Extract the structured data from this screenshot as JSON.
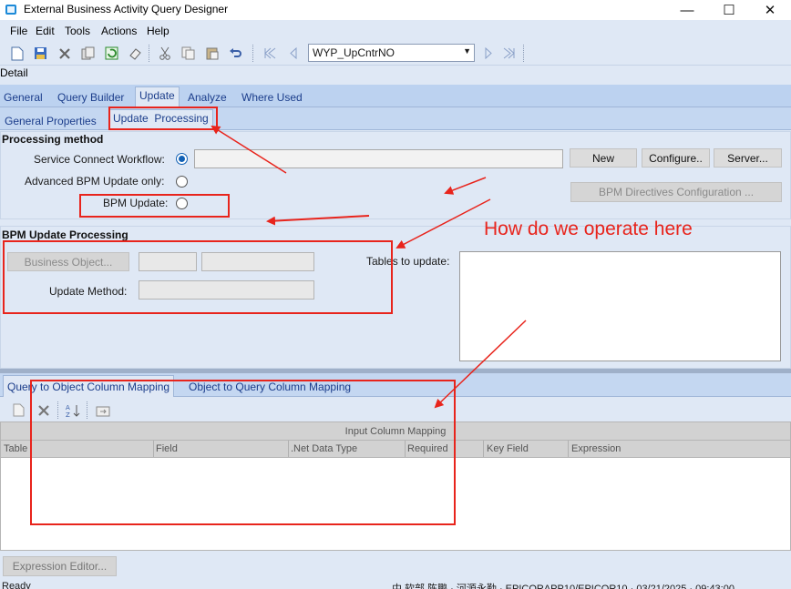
{
  "window": {
    "title": "External Business Activity Query Designer",
    "controls": {
      "minimize": "—",
      "maximize": "☐",
      "close": "✕"
    }
  },
  "menu": [
    "File",
    "Edit",
    "Tools",
    "Actions",
    "Help"
  ],
  "toolbar": {
    "icons": [
      "new-icon",
      "save-icon",
      "delete-icon",
      "copy-icon",
      "refresh-icon",
      "clear-icon",
      "cut-icon",
      "duplicate-icon",
      "paste-icon",
      "undo-icon",
      "first-record-icon",
      "previous-record-icon",
      "next-record-icon",
      "last-record-icon"
    ],
    "record_combo": "WYP_UpCntrNO"
  },
  "detail_label": "Detail",
  "main_tabs": [
    {
      "label": "General",
      "active": false
    },
    {
      "label": "Query Builder",
      "active": false
    },
    {
      "label": "Update",
      "active": true
    },
    {
      "label": "Analyze",
      "active": false
    },
    {
      "label": "Where Used",
      "active": false
    }
  ],
  "sub_tabs": [
    {
      "label": "General Properties",
      "active": false
    },
    {
      "label": "Update  Processing",
      "active": true
    }
  ],
  "processing_method": {
    "title": "Processing method",
    "service_connect_label": "Service Connect Workflow:",
    "advanced_bpm_label": "Advanced BPM Update only:",
    "bpm_update_label": "BPM Update:",
    "selected": "service_connect",
    "new_button": "New",
    "configure_button": "Configure..",
    "server_button": "Server...",
    "bpm_directives_button": "BPM Directives Configuration ..."
  },
  "bpm_update_processing": {
    "title": "BPM Update Processing",
    "business_object_button": "Business Object...",
    "update_method_label": "Update Method:",
    "tables_to_update_label": "Tables to update:"
  },
  "lower_tabs": [
    {
      "label": "Query to Object Column Mapping",
      "active": true
    },
    {
      "label": "Object to Query Column Mapping",
      "active": false
    }
  ],
  "grid": {
    "toolbar_icons": [
      "new-row-icon",
      "delete-row-icon",
      "sort-icon",
      "import-icon"
    ],
    "group_header": "Input Column Mapping",
    "columns": [
      "Table",
      "Field",
      ".Net Data Type",
      "Required",
      "Key Field",
      "Expression"
    ]
  },
  "expression_editor_button": "Expression Editor...",
  "status": {
    "left": "Ready",
    "right": "中 软部 陈鹏 · 河源永勤 · EPICORAPP10/EPICOR10 · 03/21/2025 · 09:43:00"
  },
  "annotation": {
    "text": "How do we operate here",
    "color": "#e8241c"
  }
}
